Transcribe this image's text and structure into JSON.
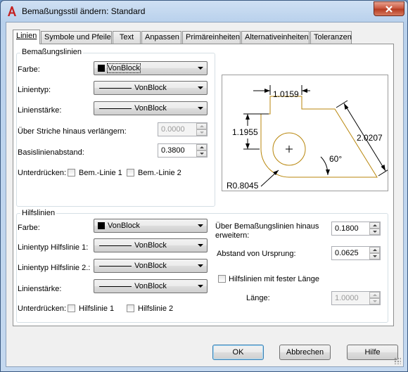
{
  "window": {
    "title": "Bemaßungsstil ändern: Standard"
  },
  "tabs": [
    {
      "label": "Linien"
    },
    {
      "label": "Symbole und Pfeile"
    },
    {
      "label": "Text"
    },
    {
      "label": "Anpassen"
    },
    {
      "label": "Primäreinheiten"
    },
    {
      "label": "Alternativeinheiten"
    },
    {
      "label": "Toleranzen"
    }
  ],
  "dimlines": {
    "group_title": "Bemaßungslinien",
    "color_label": "Farbe:",
    "color_value": "VonBlock",
    "linetype_label": "Linientyp:",
    "linetype_value": "VonBlock",
    "lineweight_label": "Linienstärke:",
    "lineweight_value": "VonBlock",
    "extend_label": "Über Striche hinaus verlängern:",
    "extend_value": "0.0000",
    "baseline_label": "Basislinienabstand:",
    "baseline_value": "0.3800",
    "suppress_label": "Unterdrücken:",
    "suppress_1": "Bem.-Linie 1",
    "suppress_2": "Bem.-Linie 2"
  },
  "extlines": {
    "group_title": "Hilfslinien",
    "color_label": "Farbe:",
    "color_value": "VonBlock",
    "linetype1_label": "Linientyp Hilfslinie 1:",
    "linetype1_value": "VonBlock",
    "linetype2_label": "Linientyp Hilfslinie 2.:",
    "linetype2_value": "VonBlock",
    "lineweight_label": "Linienstärke:",
    "lineweight_value": "VonBlock",
    "suppress_label": "Unterdrücken:",
    "suppress_1": "Hilfslinie 1",
    "suppress_2": "Hilfslinie 2",
    "extend_label_1": "Über Bemaßungslinien hinaus",
    "extend_label_2": "erweitern:",
    "extend_value": "0.1800",
    "offset_label": "Abstand von Ursprung:",
    "offset_value": "0.0625",
    "fixed_label": "Hilfslinien mit fester Länge",
    "length_label": "Länge:",
    "length_value": "1.0000"
  },
  "preview": {
    "dim_top": "1.0159",
    "dim_left": "1.1955",
    "dim_right": "2.0207",
    "dim_angle": "60°",
    "dim_radius": "R0.8045"
  },
  "buttons": {
    "ok": "OK",
    "cancel": "Abbrechen",
    "help": "Hilfe"
  },
  "colors": {
    "accent": "#b8860b",
    "titlebar": "#b9d1ec",
    "close": "#c7533a"
  }
}
